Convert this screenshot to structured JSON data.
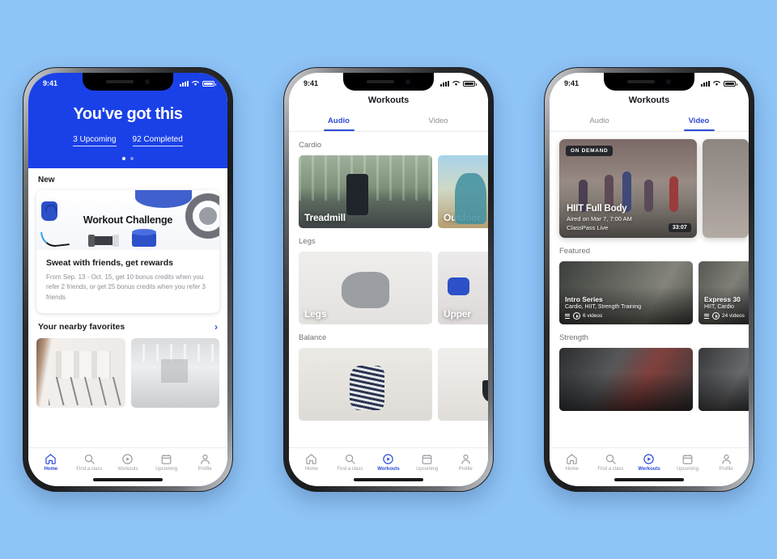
{
  "background_color": "#8FC4F7",
  "accent_color": "#2C4BD6",
  "hero_color": "#1A41E8",
  "phones": [
    {
      "id": "phone-home",
      "status": {
        "time": "9:41"
      },
      "hero": {
        "title": "You've got this",
        "stat_upcoming": "3 Upcoming",
        "stat_completed": "92 Completed"
      },
      "new_label": "New",
      "promo": {
        "image_title": "Workout Challenge",
        "headline": "Sweat with friends, get rewards",
        "body": "From Sep. 13 - Oct. 15, get 10 bonus credits when you refer 2 friends, or get 25 bonus credits when you refer 3 friends"
      },
      "favorites": {
        "title": "Your nearby favorites",
        "chevron": "›"
      },
      "tabbar": [
        {
          "label": "Home",
          "icon": "home-icon",
          "active": true
        },
        {
          "label": "Find a class",
          "icon": "search-icon",
          "active": false
        },
        {
          "label": "Workouts",
          "icon": "play-circle-icon",
          "active": false
        },
        {
          "label": "Upcoming",
          "icon": "calendar-icon",
          "active": false
        },
        {
          "label": "Profile",
          "icon": "person-icon",
          "active": false
        }
      ]
    },
    {
      "id": "phone-audio",
      "status": {
        "time": "9:41"
      },
      "nav_title": "Workouts",
      "tabs": [
        {
          "label": "Audio",
          "active": true
        },
        {
          "label": "Video",
          "active": false
        }
      ],
      "groups": [
        {
          "label": "Cardio",
          "tiles": [
            {
              "caption": "Treadmill"
            },
            {
              "caption": "Outdoor"
            }
          ]
        },
        {
          "label": "Legs",
          "tiles": [
            {
              "caption": "Legs"
            },
            {
              "caption": "Upper"
            }
          ]
        },
        {
          "label": "Balance",
          "tiles": [
            {
              "caption": ""
            },
            {
              "caption": ""
            }
          ]
        }
      ],
      "tabbar": [
        {
          "label": "Home",
          "icon": "home-icon",
          "active": false
        },
        {
          "label": "Find a class",
          "icon": "search-icon",
          "active": false
        },
        {
          "label": "Workouts",
          "icon": "play-circle-icon",
          "active": true
        },
        {
          "label": "Upcoming",
          "icon": "calendar-icon",
          "active": false
        },
        {
          "label": "Profile",
          "icon": "person-icon",
          "active": false
        }
      ]
    },
    {
      "id": "phone-video",
      "status": {
        "time": "9:41"
      },
      "nav_title": "Workouts",
      "tabs": [
        {
          "label": "Audio",
          "active": false
        },
        {
          "label": "Video",
          "active": true
        }
      ],
      "featured_video": {
        "badge": "ON DEMAND",
        "title": "HIIT Full Body",
        "aired": "Aired on Mar 7, 7:00 AM",
        "provider": "ClassPass Live",
        "duration": "33:07"
      },
      "sections": [
        {
          "label": "Featured",
          "cards": [
            {
              "title": "Intro Series",
              "subtitle": "Cardio, HIIT, Strength Training",
              "count": "6 videos"
            },
            {
              "title": "Express 30",
              "subtitle": "HIIT, Cardio",
              "count": "24 videos"
            }
          ]
        },
        {
          "label": "Strength",
          "cards": [
            {
              "title": "",
              "subtitle": "",
              "count": ""
            }
          ]
        }
      ],
      "tabbar": [
        {
          "label": "Home",
          "icon": "home-icon",
          "active": false
        },
        {
          "label": "Find a class",
          "icon": "search-icon",
          "active": false
        },
        {
          "label": "Workouts",
          "icon": "play-circle-icon",
          "active": true
        },
        {
          "label": "Upcoming",
          "icon": "calendar-icon",
          "active": false
        },
        {
          "label": "Profile",
          "icon": "person-icon",
          "active": false
        }
      ]
    }
  ]
}
